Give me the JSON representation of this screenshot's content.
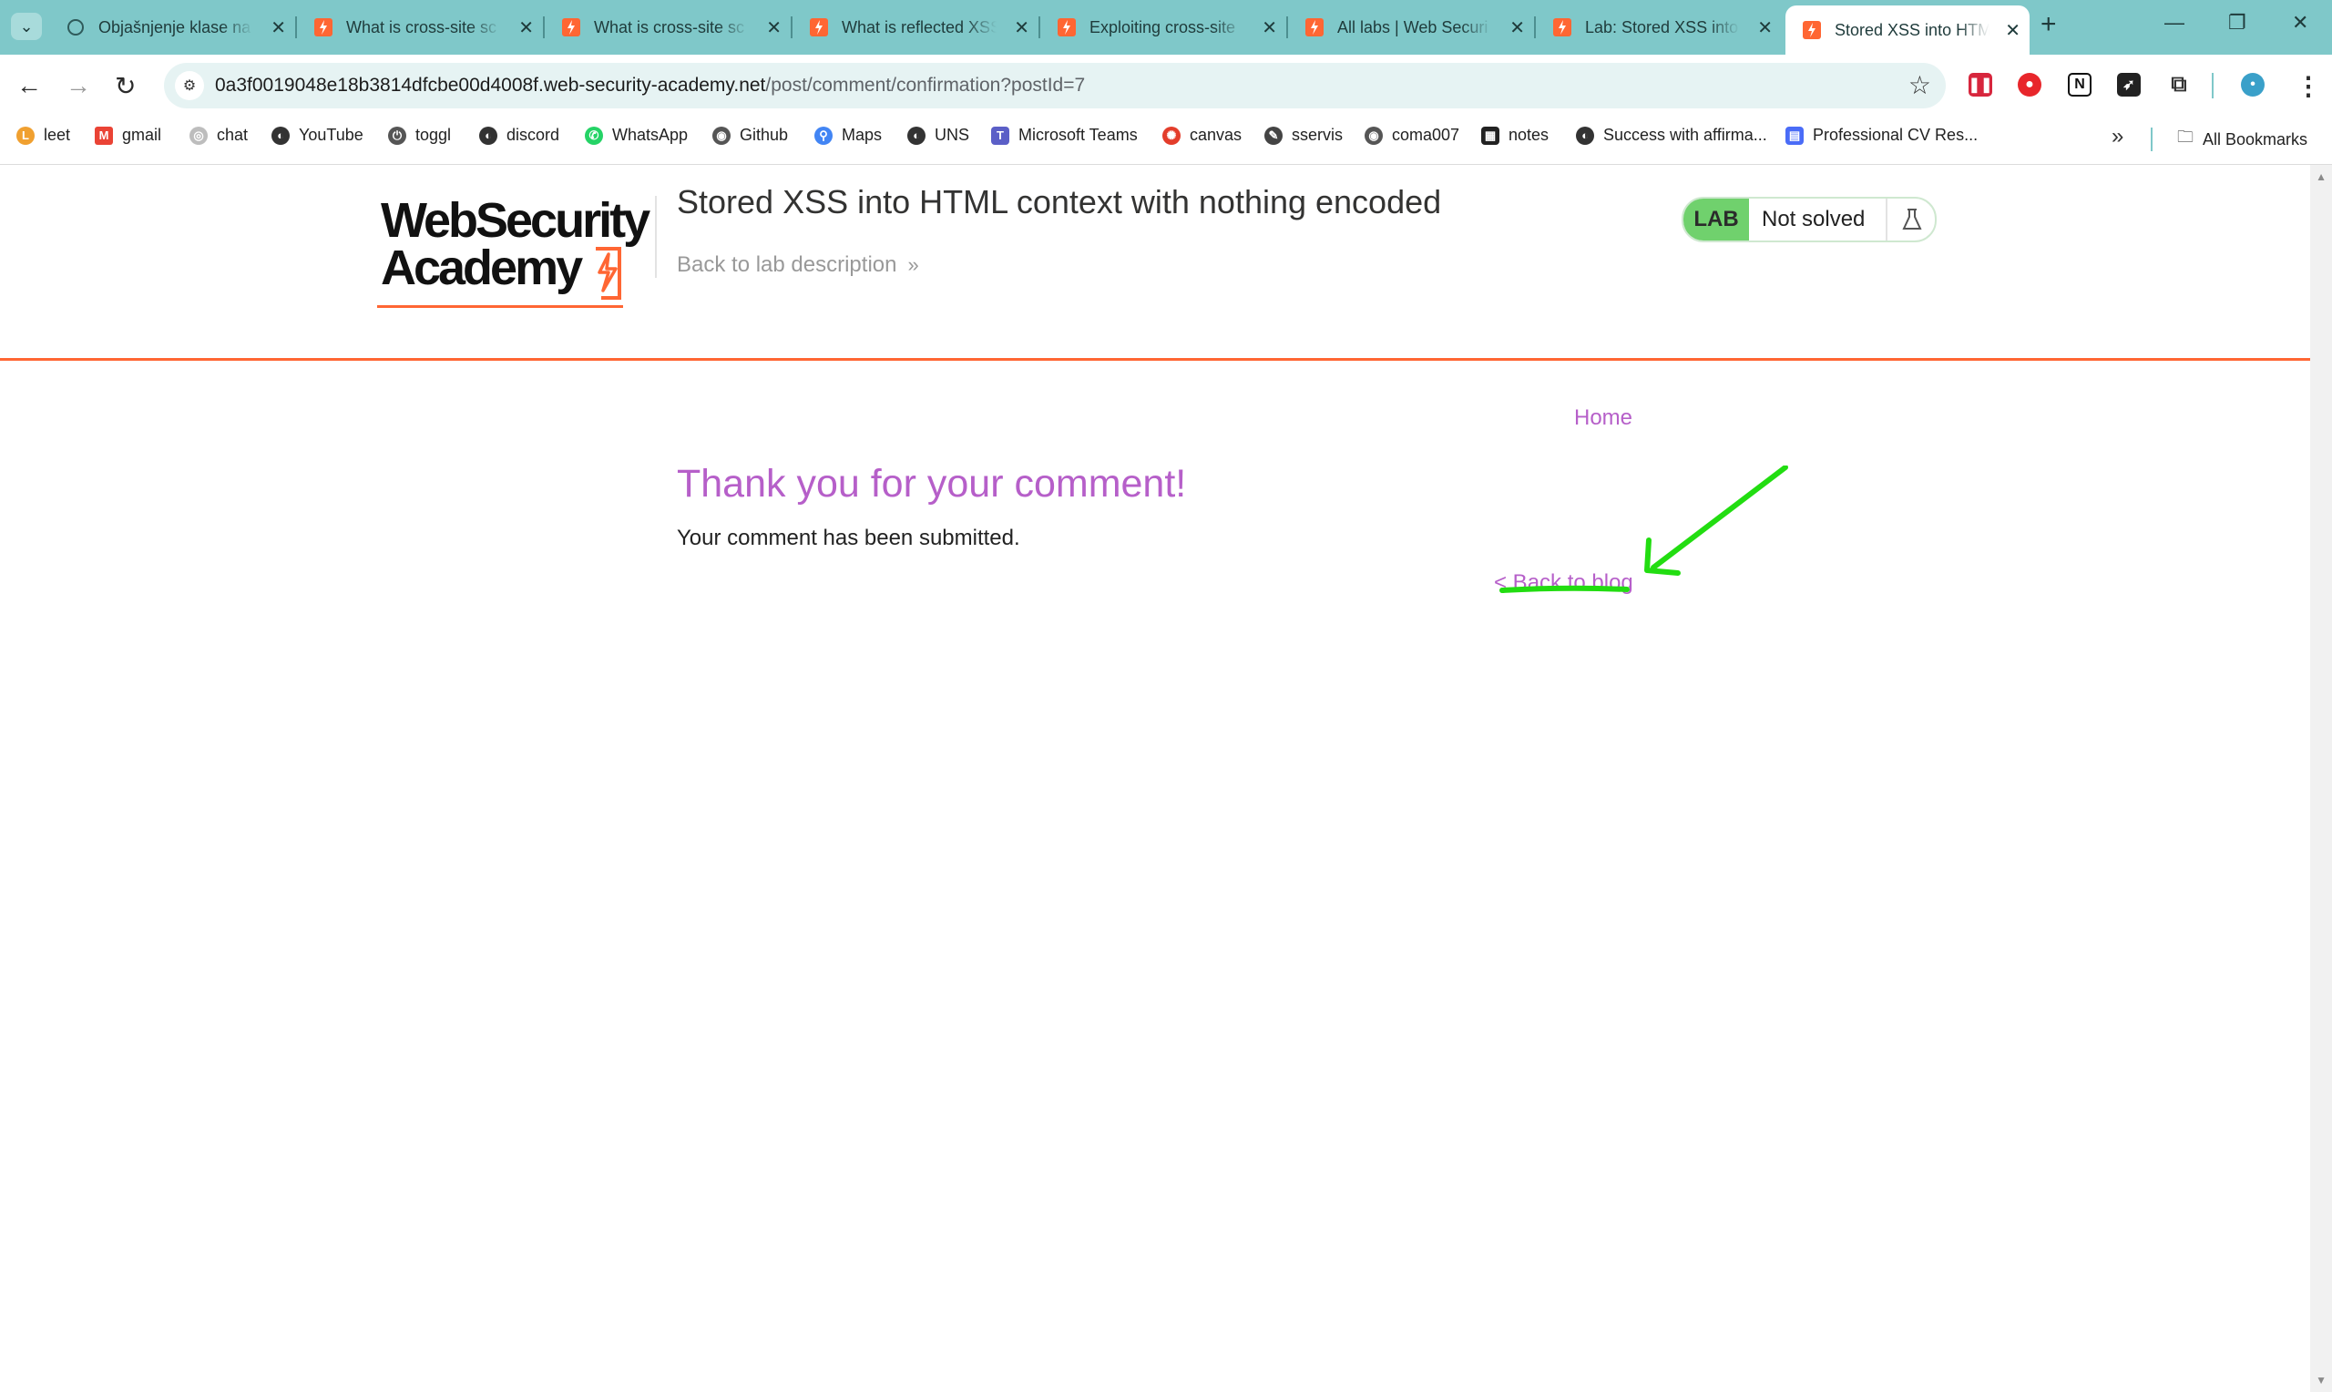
{
  "browser": {
    "tabs": [
      {
        "title": "Objašnjenje klase na",
        "favicon": "openai-icon",
        "active": false
      },
      {
        "title": "What is cross-site sc",
        "favicon": "portswigger-icon",
        "active": false
      },
      {
        "title": "What is cross-site sc",
        "favicon": "portswigger-icon",
        "active": false
      },
      {
        "title": "What is reflected XSS",
        "favicon": "portswigger-icon",
        "active": false
      },
      {
        "title": "Exploiting cross-site",
        "favicon": "portswigger-icon",
        "active": false
      },
      {
        "title": "All labs | Web Securi",
        "favicon": "portswigger-icon",
        "active": false
      },
      {
        "title": "Lab: Stored XSS into",
        "favicon": "portswigger-icon",
        "active": false
      },
      {
        "title": "Stored XSS into HTM",
        "favicon": "portswigger-icon",
        "active": true
      }
    ],
    "new_tab": "+",
    "url_domain": "0a3f0019048e18b3814dfcbe00d4008f.web-security-academy.net",
    "url_path": "/post/comment/confirmation?postId=7",
    "bookmarks": [
      {
        "label": "leet",
        "icon": "leetcode-icon",
        "color": "#f0a030"
      },
      {
        "label": "gmail",
        "icon": "gmail-icon",
        "color": "#ea4335"
      },
      {
        "label": "chat",
        "icon": "openai-icon",
        "color": "#bdbdbd"
      },
      {
        "label": "YouTube",
        "icon": "globe-icon",
        "color": "#333333"
      },
      {
        "label": "toggl",
        "icon": "toggl-icon",
        "color": "#555555"
      },
      {
        "label": "discord",
        "icon": "globe-icon",
        "color": "#333333"
      },
      {
        "label": "WhatsApp",
        "icon": "whatsapp-icon",
        "color": "#25d366"
      },
      {
        "label": "Github",
        "icon": "github-icon",
        "color": "#555555"
      },
      {
        "label": "Maps",
        "icon": "maps-icon",
        "color": "#4285f4"
      },
      {
        "label": "UNS",
        "icon": "globe-icon",
        "color": "#333333"
      },
      {
        "label": "Microsoft Teams",
        "icon": "teams-icon",
        "color": "#5b5fc7"
      },
      {
        "label": "canvas",
        "icon": "canvas-icon",
        "color": "#e33d2b"
      },
      {
        "label": "sservis",
        "icon": "sservis-icon",
        "color": "#444444"
      },
      {
        "label": "coma007",
        "icon": "github-icon",
        "color": "#555555"
      },
      {
        "label": "notes",
        "icon": "notes-icon",
        "color": "#222222"
      },
      {
        "label": "Success with affirma...",
        "icon": "globe-icon",
        "color": "#333333"
      },
      {
        "label": "Professional CV Res...",
        "icon": "cv-icon",
        "color": "#4a6cf7"
      }
    ],
    "bookmarks_overflow": "»",
    "all_bookmarks": "All Bookmarks"
  },
  "header": {
    "logo_line1": "WebSecurity",
    "logo_line2": "Academy",
    "lab_title": "Stored XSS into HTML context with nothing encoded",
    "back_to_description": "Back to lab description",
    "status_tag": "LAB",
    "status_text": "Not solved"
  },
  "nav": {
    "home": "Home"
  },
  "main": {
    "heading": "Thank you for your comment!",
    "message": "Your comment has been submitted.",
    "back_link": "< Back to blog"
  },
  "colors": {
    "accent_orange": "#ff6633",
    "link_purple": "#b65fc9",
    "lab_green": "#70d16d",
    "annotation_green": "#22dd11",
    "tabbar_teal": "#7fc8c9"
  }
}
